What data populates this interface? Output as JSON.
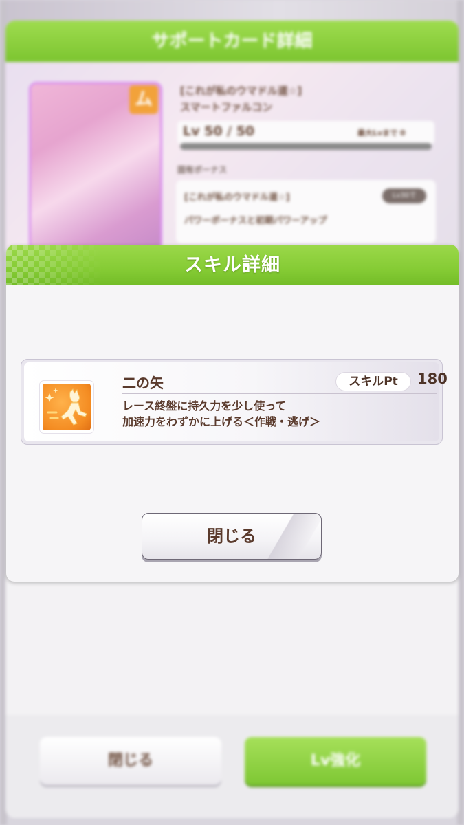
{
  "background": {
    "header_title": "サポートカード詳細",
    "card_title": "[これが私のウマドル道☆]\nスマートファルコン",
    "level_text": "Lv 50 / 50",
    "level_right": "最大Lvまで 0",
    "bonus_heading": "固有ボーナス",
    "bonus_line1": "[これが私のウマドル道☆]",
    "bonus_pill": "Lv30で",
    "bonus_line2": "パワーボーナスと初期パワーアップ",
    "close_label": "閉じる",
    "lv_up_label": "Lv強化"
  },
  "modal": {
    "title": "スキル詳細",
    "skill": {
      "name": "二の矢",
      "pt_label": "スキルPt",
      "pt_value": "180",
      "desc_line1": "レース終盤に持久力を少し使って",
      "desc_line2": "加速力をわずかに上げる＜作戦・逃げ＞",
      "icon": "running-speed-icon"
    },
    "close_label": "閉じる"
  },
  "colors": {
    "header_green": "#86cc35",
    "text_brown": "#5a3a2c",
    "icon_orange": "#f48c22"
  }
}
